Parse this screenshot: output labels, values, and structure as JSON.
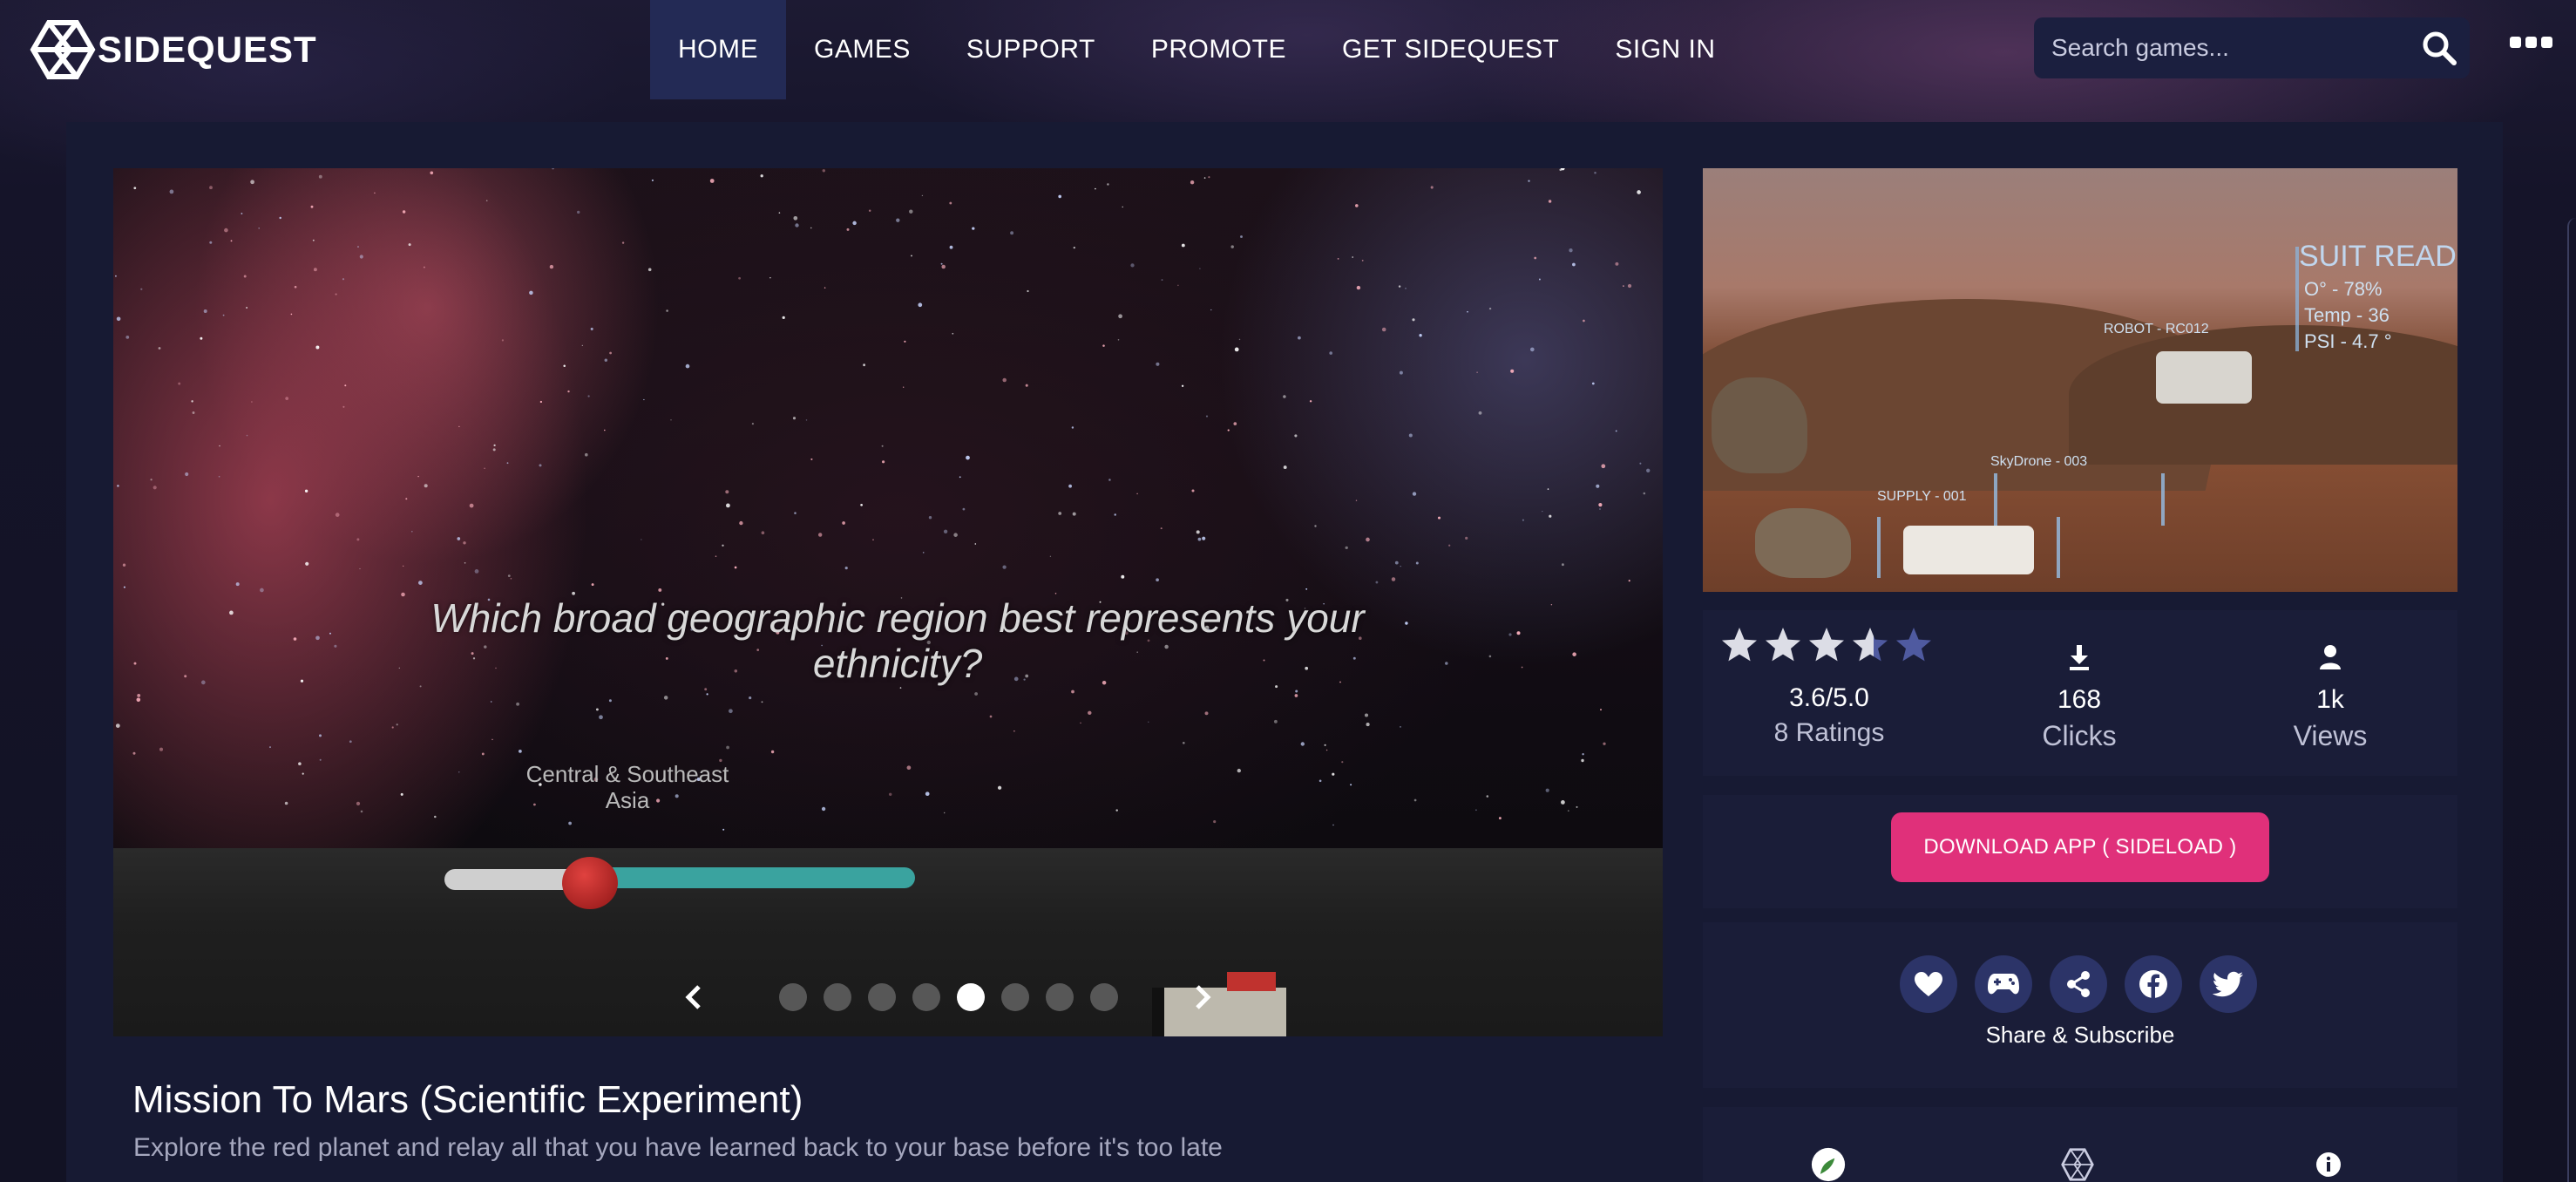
{
  "brand": {
    "name": "SIDEQUEST"
  },
  "nav": {
    "items": [
      {
        "label": "HOME",
        "active": true
      },
      {
        "label": "GAMES"
      },
      {
        "label": "SUPPORT"
      },
      {
        "label": "PROMOTE"
      },
      {
        "label": "GET SIDEQUEST"
      },
      {
        "label": "SIGN IN"
      }
    ]
  },
  "search": {
    "placeholder": "Search games...",
    "icon": "search-icon"
  },
  "menu": {
    "icon": "more-icon"
  },
  "slideshow": {
    "question": "Which broad geographic region best represents your ethnicity?",
    "region_label": "Central & Southeast Asia",
    "slider_level": 0.31,
    "slide_count": 8,
    "active_slide": 5
  },
  "game": {
    "title": "Mission To Mars (Scientific Experiment)",
    "description": "Explore the red planet and relay all that you have learned back to your base before it's too late"
  },
  "cover": {
    "hud_title": "SUIT READ",
    "hud_lines": [
      "O° - 78%",
      "Temp - 36",
      "PSI - 4.7 °"
    ],
    "tag_rover": "ROBOT - RC012",
    "tag_drone": "SkyDrone - 003",
    "tag_supply": "SUPPLY - 001"
  },
  "stats": {
    "rating": "3.6/5.0",
    "rating_value": 3.6,
    "rating_max": 5,
    "ratings_count": "8 Ratings",
    "clicks_value": "168",
    "clicks_label": "Clicks",
    "views_value": "1k",
    "views_label": "Views"
  },
  "download": {
    "label": "DOWNLOAD APP ( SIDELOAD )"
  },
  "share": {
    "label": "Share & Subscribe",
    "icons": [
      "heart-icon",
      "gamepad-icon",
      "share-icon",
      "facebook-icon",
      "twitter-icon"
    ]
  },
  "colors": {
    "accent": "#e0307a",
    "nav_active": "#232a55",
    "panel": "#171a33",
    "card": "#1a1d38",
    "share_button": "#2c3468",
    "star_filled": "#dcdde6",
    "star_empty": "#4f5aa0"
  }
}
